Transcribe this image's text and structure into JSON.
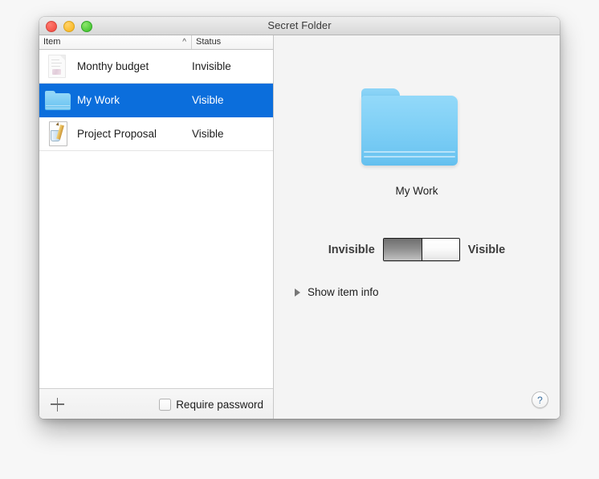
{
  "window": {
    "title": "Secret Folder",
    "traffic_lights": [
      "close",
      "minimize",
      "maximize"
    ]
  },
  "list": {
    "columns": [
      {
        "key": "item",
        "label": "Item",
        "sort": "ascending",
        "sort_glyph": "^"
      },
      {
        "key": "status",
        "label": "Status"
      }
    ],
    "rows": [
      {
        "name": "Monthy budget",
        "status": "Invisible",
        "icon": "document-faded-icon",
        "selected": false
      },
      {
        "name": "My Work",
        "status": "Visible",
        "icon": "folder-icon",
        "selected": true
      },
      {
        "name": "Project Proposal",
        "status": "Visible",
        "icon": "document-pencil-icon",
        "selected": false
      }
    ]
  },
  "left_bottom_bar": {
    "add_button_label": "+",
    "require_password_label": "Require password",
    "require_password_checked": false
  },
  "detail": {
    "icon": "folder-icon-large",
    "item_name": "My Work",
    "switch": {
      "left_label": "Invisible",
      "right_label": "Visible",
      "position": "right"
    },
    "disclosure": {
      "label": "Show item info",
      "expanded": false
    },
    "help_label": "?"
  },
  "colors": {
    "selection_blue": "#0b6edc",
    "folder_blue": "#80d0f6",
    "panel_gray": "#f4f4f4",
    "titlebar_gray": "#e3e3e3",
    "help_blue": "#3b6fa0"
  }
}
